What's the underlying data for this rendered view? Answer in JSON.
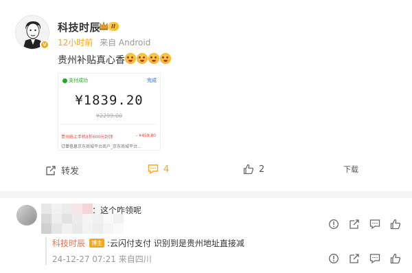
{
  "post": {
    "username": "科技时辰",
    "level_badge": "II",
    "time_ago": "12小时前",
    "source": "来自 Android",
    "text": "贵州补贴真心香",
    "emoji_count": 4,
    "emoji_name": "drool-emoji-icon"
  },
  "pay_card": {
    "status": "支付成功",
    "done": "完成",
    "amount": "¥1839.20",
    "original_price": "¥2299.00",
    "promo": "贵州线上手机8折600元封顶",
    "discount": "- ¥459.80",
    "order_label": "订单信息",
    "order_value": "京东商城平台商户_京东商城平台..."
  },
  "actions": {
    "repost_label": "转发",
    "comment_count": "4",
    "like_count": "2",
    "download_label": "下载",
    "accent": "#f7a61c"
  },
  "comment": {
    "text": "：这个咋领呢",
    "icons": [
      "report-icon",
      "share-icon",
      "comment-icon",
      "like-icon"
    ]
  },
  "reply": {
    "author": "科技时辰",
    "badge": "博主",
    "text": ":云闪付支付  识别到是贵州地址直接减",
    "timestamp": "24-12-27 07:21",
    "location": "来自四川",
    "name_color": "#eb7350"
  }
}
